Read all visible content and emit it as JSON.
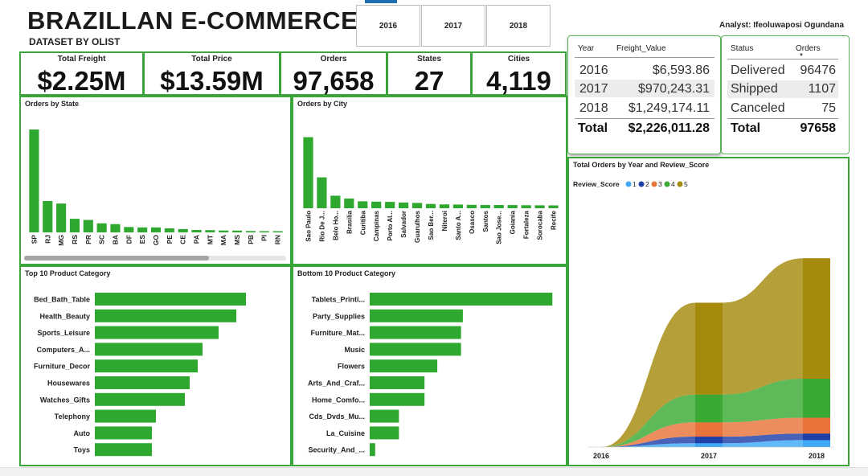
{
  "header": {
    "title": "BRAZILLAN E-COMMERCE",
    "subtitle": "DATASET BY OLIST",
    "analyst": "Analyst: Ifeoluwaposi Ogundana"
  },
  "year_slicer": [
    "2016",
    "2017",
    "2018"
  ],
  "kpis": [
    {
      "label": "Total Freight",
      "value": "$2.25M"
    },
    {
      "label": "Total Price",
      "value": "$13.59M"
    },
    {
      "label": "Orders",
      "value": "97,658"
    },
    {
      "label": "States",
      "value": "27"
    },
    {
      "label": "Cities",
      "value": "4,119"
    }
  ],
  "freight_table": {
    "headers": [
      "Year",
      "Freight_Value"
    ],
    "rows": [
      [
        "2016",
        "$6,593.86"
      ],
      [
        "2017",
        "$970,243.31"
      ],
      [
        "2018",
        "$1,249,174.11"
      ]
    ],
    "total": [
      "Total",
      "$2,226,011.28"
    ]
  },
  "status_table": {
    "headers": [
      "Status",
      "Orders"
    ],
    "rows": [
      [
        "Delivered",
        "96476"
      ],
      [
        "Shipped",
        "1107"
      ],
      [
        "Canceled",
        "75"
      ]
    ],
    "total": [
      "Total",
      "97658"
    ]
  },
  "colors": {
    "bar": "#2ea82e",
    "panel_border": "#3aa63a",
    "row_highlight": "#ececec",
    "review_1": "#3fa9f5",
    "review_2": "#1f3fa8",
    "review_3": "#e8743b",
    "review_4": "#3aaa35",
    "review_5": "#a58a0e"
  },
  "chart_data": [
    {
      "type": "bar",
      "title": "Orders by State",
      "categories": [
        "SP",
        "RJ",
        "MG",
        "RS",
        "PR",
        "SC",
        "BA",
        "DF",
        "ES",
        "GO",
        "PE",
        "CE",
        "PA",
        "MT",
        "MA",
        "MS",
        "PB",
        "PI",
        "RN"
      ],
      "values": [
        40500,
        12350,
        11350,
        5350,
        4900,
        3550,
        3250,
        2100,
        1950,
        1950,
        1600,
        1300,
        950,
        880,
        720,
        700,
        520,
        470,
        470
      ],
      "ylim": [
        0,
        44000
      ]
    },
    {
      "type": "bar",
      "title": "Orders by City",
      "categories": [
        "Sao Paulo",
        "Rio De J...",
        "Belo Ho...",
        "Brasilia",
        "Curitiba",
        "Campinas",
        "Porto Al...",
        "Salvador",
        "Guarulhos",
        "Sao Ber...",
        "Niteroi",
        "Santo A...",
        "Osasco",
        "Santos",
        "Sao Jose...",
        "Goiania",
        "Fortaleza",
        "Sorocaba",
        "Recife"
      ],
      "values": [
        15300,
        6650,
        2700,
        2100,
        1500,
        1420,
        1370,
        1240,
        1150,
        930,
        830,
        800,
        730,
        700,
        690,
        680,
        650,
        630,
        610
      ],
      "ylim": [
        0,
        18000
      ]
    },
    {
      "type": "bar",
      "title": "Top 10 Product Category",
      "orientation": "horizontal",
      "categories": [
        "Bed_Bath_Table",
        "Health_Beauty",
        "Sports_Leisure",
        "Computers_A...",
        "Furniture_Decor",
        "Housewares",
        "Watches_Gifts",
        "Telephony",
        "Auto",
        "Toys"
      ],
      "values": [
        9400,
        8800,
        7700,
        6700,
        6400,
        5900,
        5600,
        3800,
        3550,
        3550
      ],
      "xlim": [
        0,
        11000
      ]
    },
    {
      "type": "bar",
      "title": "Bottom 10 Product Category",
      "orientation": "horizontal",
      "categories": [
        "Tablets_Printi...",
        "Party_Supplies",
        "Furniture_Mat...",
        "Music",
        "Flowers",
        "Arts_And_Craf...",
        "Home_Comfo...",
        "Cds_Dvds_Mu...",
        "La_Cuisine",
        "Security_And_..."
      ],
      "values": [
        100,
        51,
        50,
        50,
        37,
        30,
        30,
        16,
        16,
        3
      ],
      "xlim": [
        0,
        110
      ]
    },
    {
      "type": "area",
      "title": "Total Orders by Year and Review_Score",
      "legend_title": "Review_Score",
      "legend_position": "top-left",
      "x": [
        "2016",
        "2017",
        "2018"
      ],
      "series": [
        {
          "name": "1",
          "values": [
            0,
            1000,
            1800
          ]
        },
        {
          "name": "2",
          "values": [
            0,
            1700,
            1700
          ]
        },
        {
          "name": "3",
          "values": [
            0,
            3700,
            4100
          ]
        },
        {
          "name": "4",
          "values": [
            0,
            7200,
            10100
          ]
        },
        {
          "name": "5",
          "values": [
            0,
            23800,
            31200
          ]
        }
      ],
      "stacked": true,
      "ylim": [
        0,
        50000
      ]
    }
  ]
}
